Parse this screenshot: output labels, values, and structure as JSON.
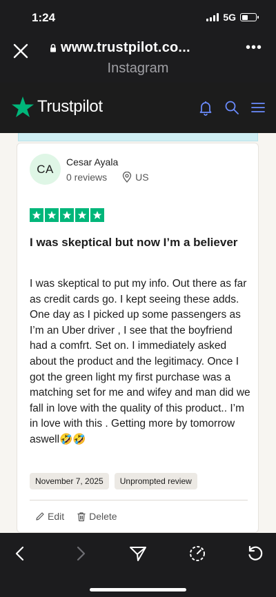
{
  "status_bar": {
    "time": "1:24",
    "network": "5G",
    "battery_level": 0.45
  },
  "browser": {
    "url": "www.trustpilot.co...",
    "subtitle": "Instagram"
  },
  "header": {
    "brand": "Trustpilot"
  },
  "reviewer": {
    "initials": "CA",
    "name": "Cesar Ayala",
    "reviews": "0 reviews",
    "country": "US"
  },
  "review": {
    "rating": 5,
    "max_rating": 5,
    "title": "I was skeptical but now I’m a believer",
    "body": "I was skeptical to put my info. Out there as far as credit cards go. I kept seeing these adds. One day as I picked up some passengers as I’m an Uber driver , I see that the boyfriend had a comfrt. Set on. I immediately asked about the product and the legitimacy. Once I got the green light my first purchase was a matching set for me and wifey and man did we fall in love with the quality of this product.. I’m in love with this . Getting more by tomorrow aswell🤣🤣",
    "date": "November 7, 2025",
    "tag": "Unprompted review"
  },
  "actions": {
    "edit": "Edit",
    "delete": "Delete"
  },
  "colors": {
    "star_green": "#00b67a",
    "icon_blue": "#6b8cff",
    "avatar_bg": "#dff6e6"
  }
}
